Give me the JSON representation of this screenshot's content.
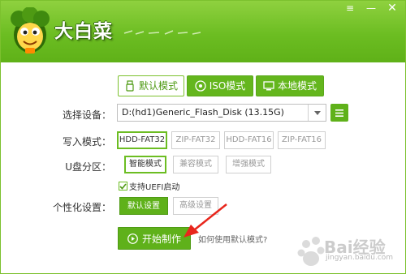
{
  "header": {
    "brand": "大白菜",
    "window_controls": {
      "menu_icon": "menu-icon",
      "minimize_icon": "minimize-icon",
      "close_icon": "close-icon"
    }
  },
  "mode_tabs": [
    {
      "label": "默认模式",
      "icon": "usb-icon",
      "selected": true
    },
    {
      "label": "ISO模式",
      "icon": "disc-icon",
      "selected": false
    },
    {
      "label": "本地模式",
      "icon": "monitor-icon",
      "selected": false
    }
  ],
  "form": {
    "device": {
      "label": "选择设备：",
      "value": "D:(hd1)Generic_Flash_Disk (13.15G)"
    },
    "write_mode": {
      "label": "写入模式：",
      "options": [
        "HDD-FAT32",
        "ZIP-FAT32",
        "HDD-FAT16",
        "ZIP-FAT16"
      ],
      "selected": "HDD-FAT32"
    },
    "partition": {
      "label": "U盘分区：",
      "options": [
        "智能模式",
        "兼容模式",
        "增强模式"
      ],
      "selected": "智能模式"
    },
    "uefi": {
      "label": "支持UEFI启动",
      "checked": true
    },
    "personalize": {
      "label": "个性化设置：",
      "default_label": "默认设置",
      "advanced_label": "高级设置"
    }
  },
  "actions": {
    "start_label": "开始制作",
    "help_link": "如何使用默认模式?"
  },
  "watermark": {
    "text": "Bai经验",
    "sub": "jingyan.baidu.com"
  },
  "colors": {
    "primary_green": "#64b61d",
    "header_green": "#6cbd22",
    "annotation_red": "#e8261c"
  }
}
